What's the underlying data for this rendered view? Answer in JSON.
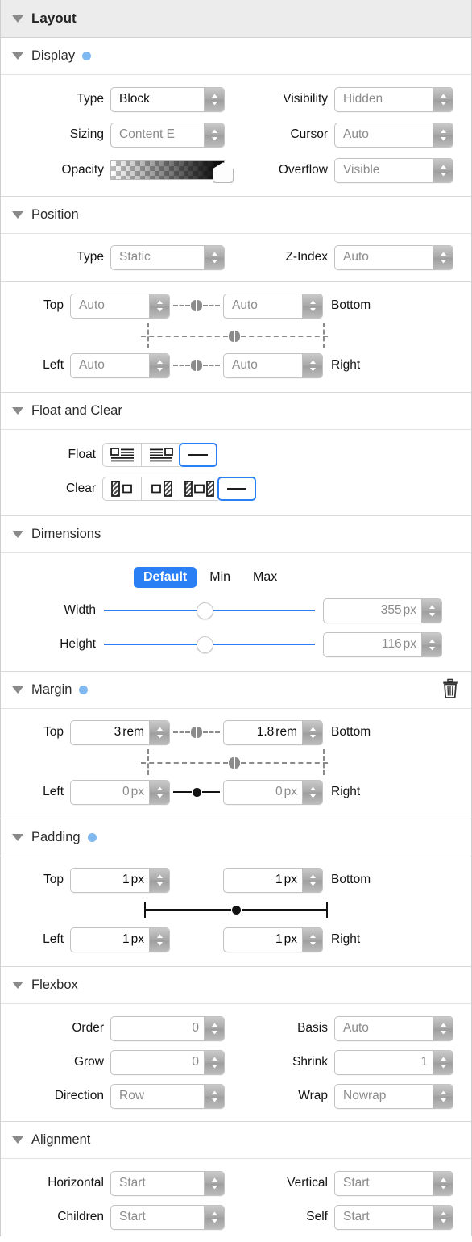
{
  "panel": {
    "title": "Layout"
  },
  "sections": {
    "display": {
      "title": "Display",
      "has_dot": true,
      "rows": [
        {
          "label": "Type",
          "value": "Block",
          "is_set": true
        },
        {
          "label": "Visibility",
          "value": "Hidden",
          "is_set": false
        },
        {
          "label": "Sizing",
          "value": "Content E",
          "is_set": false
        },
        {
          "label": "Cursor",
          "value": "Auto",
          "is_set": false
        },
        {
          "label": "Opacity",
          "value": "",
          "is_set": false
        },
        {
          "label": "Overflow",
          "value": "Visible",
          "is_set": false
        }
      ],
      "opacity_label": "Opacity"
    },
    "position": {
      "title": "Position",
      "type_label": "Type",
      "type_value": "Static",
      "zindex_label": "Z-Index",
      "zindex_value": "Auto",
      "top_label": "Top",
      "top_value": "Auto",
      "bottom_label": "Bottom",
      "bottom_value": "Auto",
      "left_label": "Left",
      "left_value": "Auto",
      "right_label": "Right",
      "right_value": "Auto"
    },
    "float_clear": {
      "title": "Float and Clear",
      "float_label": "Float",
      "float_options": [
        "float-left-icon",
        "float-right-icon",
        "float-none-icon"
      ],
      "float_selected": 2,
      "clear_label": "Clear",
      "clear_options": [
        "clear-left-icon",
        "clear-right-icon",
        "clear-both-icon",
        "clear-none-icon"
      ],
      "clear_selected": 3
    },
    "dimensions": {
      "title": "Dimensions",
      "modes": [
        "Default",
        "Min",
        "Max"
      ],
      "mode_selected": 0,
      "width_label": "Width",
      "width_value": "355",
      "width_unit": "px",
      "width_slider_pct": 44,
      "height_label": "Height",
      "height_value": "116",
      "height_unit": "px",
      "height_slider_pct": 44
    },
    "margin": {
      "title": "Margin",
      "has_dot": true,
      "has_trash": true,
      "top_label": "Top",
      "top_value": "3",
      "top_unit": "rem",
      "top_is_set": true,
      "bottom_label": "Bottom",
      "bottom_value": "1.8",
      "bottom_unit": "rem",
      "bottom_is_set": true,
      "left_label": "Left",
      "left_value": "0",
      "left_unit": "px",
      "left_is_set": false,
      "right_label": "Right",
      "right_value": "0",
      "right_unit": "px",
      "right_is_set": false
    },
    "padding": {
      "title": "Padding",
      "has_dot": true,
      "top_label": "Top",
      "top_value": "1",
      "top_unit": "px",
      "bottom_label": "Bottom",
      "bottom_value": "1",
      "bottom_unit": "px",
      "left_label": "Left",
      "left_value": "1",
      "left_unit": "px",
      "right_label": "Right",
      "right_value": "1",
      "right_unit": "px"
    },
    "flexbox": {
      "title": "Flexbox",
      "order_label": "Order",
      "order_value": "0",
      "basis_label": "Basis",
      "basis_value": "Auto",
      "grow_label": "Grow",
      "grow_value": "0",
      "shrink_label": "Shrink",
      "shrink_value": "1",
      "direction_label": "Direction",
      "direction_value": "Row",
      "wrap_label": "Wrap",
      "wrap_value": "Nowrap"
    },
    "alignment": {
      "title": "Alignment",
      "horizontal_label": "Horizontal",
      "horizontal_value": "Start",
      "vertical_label": "Vertical",
      "vertical_value": "Start",
      "children_label": "Children",
      "children_value": "Start",
      "self_label": "Self",
      "self_value": "Start"
    }
  },
  "colors": {
    "accent": "#2b7ff5",
    "dot": "#80b9f0",
    "header_bg": "#ececec"
  }
}
